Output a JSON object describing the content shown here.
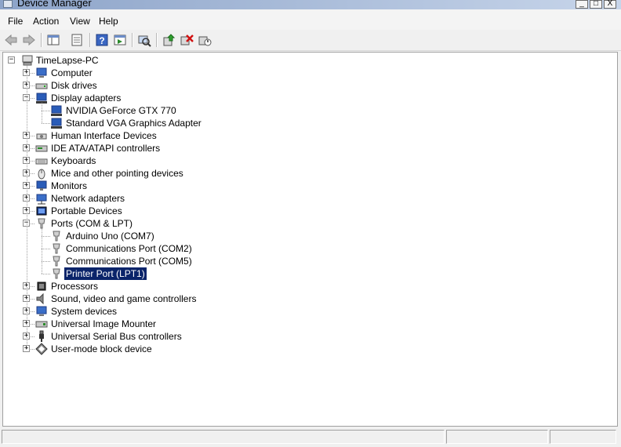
{
  "window": {
    "title": "Device Manager",
    "minimize": "_",
    "maximize": "□",
    "close": "X"
  },
  "menu": [
    "File",
    "Action",
    "View",
    "Help"
  ],
  "toolbar": [
    "back-icon",
    "forward-icon",
    "show-hide-tree-icon",
    "properties-icon",
    "help-icon",
    "action-pane-icon",
    "scan-hardware-icon",
    "update-driver-icon",
    "uninstall-icon",
    "disable-icon"
  ],
  "tree": {
    "root": "TimeLapse-PC",
    "categories": [
      {
        "label": "Computer",
        "icon": "computer-icon",
        "expanded": false
      },
      {
        "label": "Disk drives",
        "icon": "disk-drive-icon",
        "expanded": false
      },
      {
        "label": "Display adapters",
        "icon": "display-adapter-icon",
        "expanded": true,
        "children": [
          {
            "label": "NVIDIA GeForce GTX 770"
          },
          {
            "label": "Standard VGA Graphics Adapter"
          }
        ]
      },
      {
        "label": "Human Interface Devices",
        "icon": "hid-icon",
        "expanded": false
      },
      {
        "label": "IDE ATA/ATAPI controllers",
        "icon": "ide-controller-icon",
        "expanded": false
      },
      {
        "label": "Keyboards",
        "icon": "keyboard-icon",
        "expanded": false
      },
      {
        "label": "Mice and other pointing devices",
        "icon": "mouse-icon",
        "expanded": false
      },
      {
        "label": "Monitors",
        "icon": "monitor-icon",
        "expanded": false
      },
      {
        "label": "Network adapters",
        "icon": "network-adapter-icon",
        "expanded": false
      },
      {
        "label": "Portable Devices",
        "icon": "portable-device-icon",
        "expanded": false
      },
      {
        "label": "Ports (COM & LPT)",
        "icon": "port-icon",
        "expanded": true,
        "children": [
          {
            "label": "Arduino Uno (COM7)"
          },
          {
            "label": "Communications Port (COM2)"
          },
          {
            "label": "Communications Port (COM5)"
          },
          {
            "label": "Printer Port (LPT1)",
            "selected": true
          }
        ]
      },
      {
        "label": "Processors",
        "icon": "processor-icon",
        "expanded": false
      },
      {
        "label": "Sound, video and game controllers",
        "icon": "sound-icon",
        "expanded": false
      },
      {
        "label": "System devices",
        "icon": "system-device-icon",
        "expanded": false
      },
      {
        "label": "Universal Image Mounter",
        "icon": "image-mounter-icon",
        "expanded": false
      },
      {
        "label": "Universal Serial Bus controllers",
        "icon": "usb-icon",
        "expanded": false
      },
      {
        "label": "User-mode block device",
        "icon": "block-device-icon",
        "expanded": false
      }
    ]
  },
  "colors": {
    "selection": "#0a246a",
    "title_gradient_start": "#8da4c9"
  }
}
